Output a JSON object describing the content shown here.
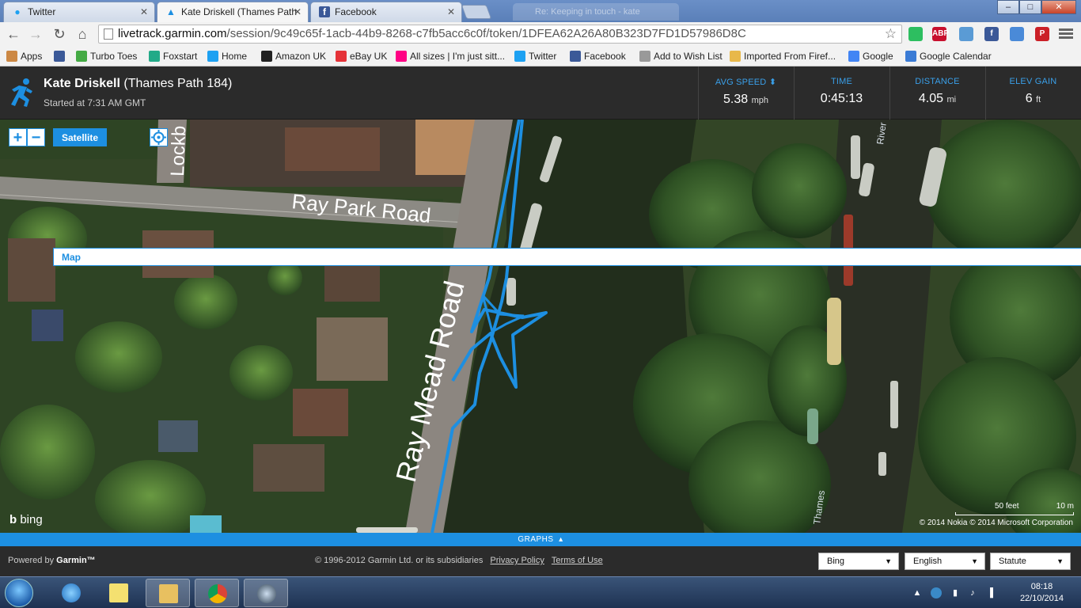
{
  "browser": {
    "tabs": [
      {
        "label": "Twitter",
        "icon": "twitter-bird-icon"
      },
      {
        "label": "Kate Driskell (Thames Path",
        "icon": "garmin-triangle-icon"
      },
      {
        "label": "Facebook",
        "icon": "facebook-f-icon"
      }
    ],
    "ghost_tab": "Re: Keeping in touch - kate",
    "url_host": "livetrack.garmin.com",
    "url_path": "/session/9c49c65f-1acb-44b9-8268-c7fb5acc6c0f/token/1DFEA62A26A80B323D7FD1D57986D8C",
    "window_buttons": {
      "minimize": "–",
      "maximize": "□",
      "close": "✕"
    },
    "extensions": [
      {
        "name": "evernote-icon",
        "label": "",
        "color": "#2dbe60"
      },
      {
        "name": "adblock-plus-icon",
        "label": "ABP",
        "color": "#c8102e"
      },
      {
        "name": "puzzle-extension-icon",
        "label": "",
        "color": "#5a9bd5"
      },
      {
        "name": "facebook-ext-icon",
        "label": "f",
        "color": "#3b5998"
      },
      {
        "name": "calendar-ext-icon",
        "label": "",
        "color": "#4a8ad8"
      },
      {
        "name": "pinterest-icon",
        "label": "P",
        "color": "#cb2027"
      }
    ],
    "bookmarks": [
      {
        "label": "Apps",
        "icon": "apps-grid-icon",
        "color": "#c84"
      },
      {
        "label": "",
        "icon": "facebook-f-icon",
        "color": "#3b5998"
      },
      {
        "label": "Turbo Toes",
        "icon": "turbo-toes-icon",
        "color": "#4a4"
      },
      {
        "label": "Foxstart",
        "icon": "foxstart-icon",
        "color": "#2a8"
      },
      {
        "label": "Home",
        "icon": "twitter-bird-icon",
        "color": "#1da1f2"
      },
      {
        "label": "Amazon UK",
        "icon": "amazon-icon",
        "color": "#222"
      },
      {
        "label": "eBay UK",
        "icon": "ebay-icon",
        "color": "#e53238"
      },
      {
        "label": "All sizes | I'm just sitt...",
        "icon": "flickr-icon",
        "color": "#ff0084"
      },
      {
        "label": "Twitter",
        "icon": "twitter-bird-icon",
        "color": "#1da1f2"
      },
      {
        "label": "Facebook",
        "icon": "facebook-f-icon",
        "color": "#3b5998"
      },
      {
        "label": "Add to Wish List",
        "icon": "page-icon",
        "color": "#999"
      },
      {
        "label": "Imported From Firef...",
        "icon": "folder-icon",
        "color": "#e8b84a"
      },
      {
        "label": "Google",
        "icon": "google-icon",
        "color": "#4285f4"
      },
      {
        "label": "Google Calendar",
        "icon": "calendar-icon",
        "color": "#3a7bd5"
      }
    ]
  },
  "session": {
    "athlete_name": "Kate Driskell",
    "event": "(Thames Path 184)",
    "started": "Started at 7:31 AM GMT",
    "stats": [
      {
        "label": "AVG SPEED",
        "sort": "⬍",
        "value": "5.38",
        "unit": "mph"
      },
      {
        "label": "TIME",
        "sort": "",
        "value": "0:45:13",
        "unit": ""
      },
      {
        "label": "DISTANCE",
        "sort": "",
        "value": "4.05",
        "unit": "mi"
      },
      {
        "label": "ELEV GAIN",
        "sort": "",
        "value": "6",
        "unit": "ft"
      }
    ]
  },
  "map": {
    "controls": {
      "zoom_in": "+",
      "zoom_out": "−",
      "map": "Map",
      "satellite": "Satellite",
      "active_type": "Satellite"
    },
    "labels": {
      "road1": "Ray Park Road",
      "road2": "Ray Mead Road",
      "road3": "Lockb",
      "river1": "River",
      "river2": "Thames"
    },
    "provider": "bing",
    "copyright": "© 2014 Nokia   © 2014 Microsoft Corporation",
    "scale": {
      "feet": "50 feet",
      "meters": "10 m"
    },
    "route_color": "#1d8fe1"
  },
  "graphs_toggle": "GRAPHS",
  "footer": {
    "powered_prefix": "Powered by ",
    "powered_brand": "Garmin™",
    "copyright": "© 1996-2012 Garmin Ltd. or its subsidiaries",
    "privacy": "Privacy Policy",
    "terms": "Terms of Use",
    "selects": [
      {
        "name": "map-provider-select",
        "value": "Bing"
      },
      {
        "name": "language-select",
        "value": "English"
      },
      {
        "name": "units-select",
        "value": "Statute"
      }
    ]
  },
  "taskbar": {
    "time": "08:18",
    "date": "22/10/2014"
  },
  "colors": {
    "accent": "#1d8fe1",
    "header_bg": "#2b2b2b"
  }
}
